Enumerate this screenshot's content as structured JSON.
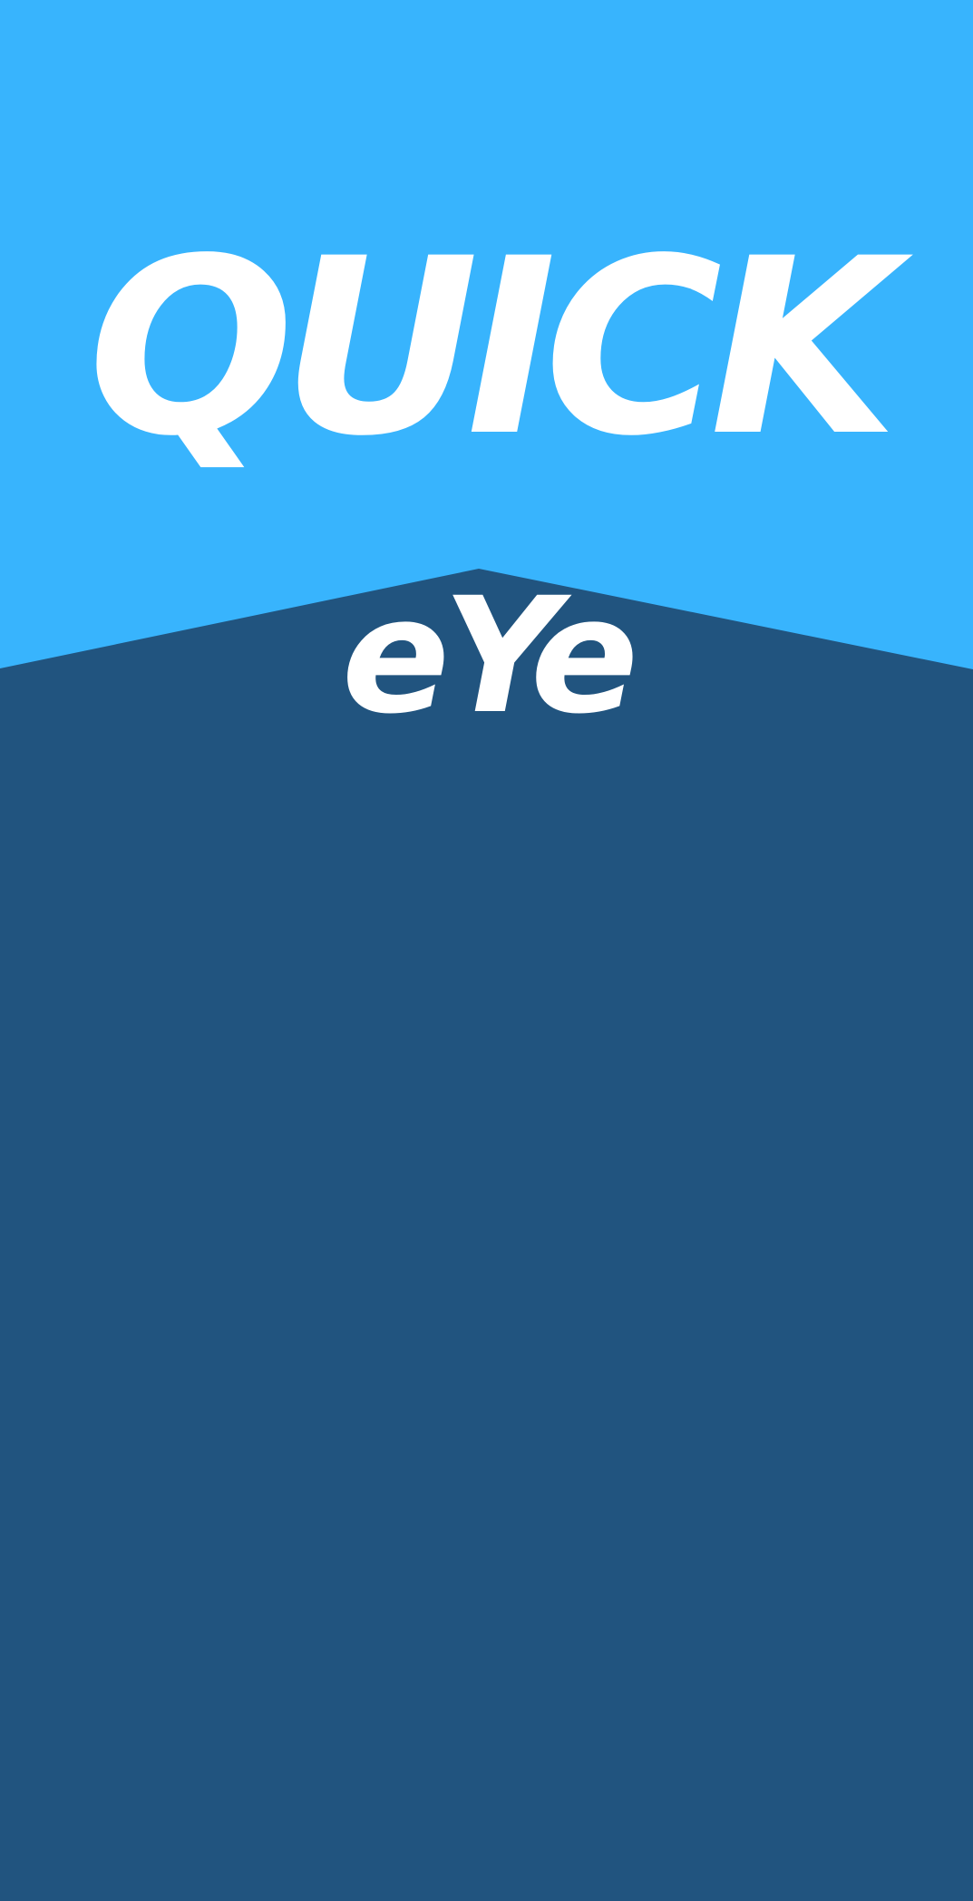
{
  "splash": {
    "logo_line_1": "QUICK",
    "logo_line_2": "eYe"
  },
  "colors": {
    "top_background": "#38b4fd",
    "bottom_background": "#21547f",
    "logo_text": "#ffffff"
  }
}
